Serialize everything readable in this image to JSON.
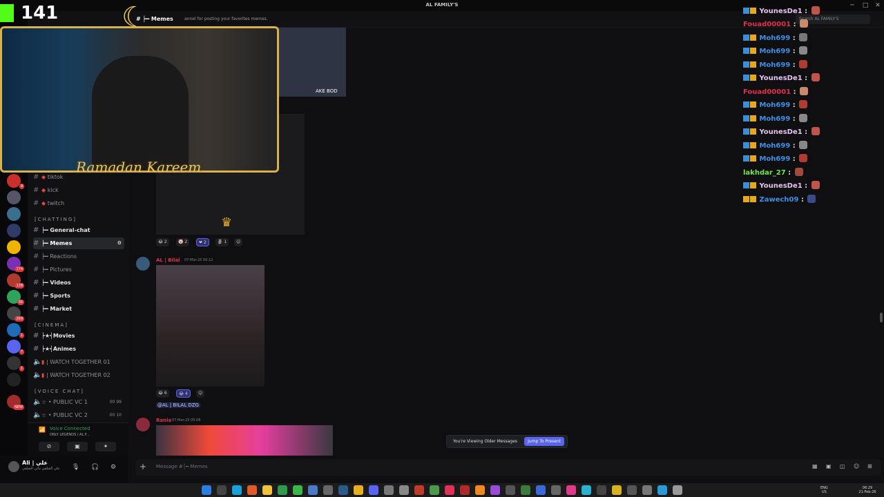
{
  "window": {
    "title": "AL FAMILY'S"
  },
  "server": {
    "name": "AL FAMILY'S"
  },
  "channel": {
    "name": "Memes",
    "topic": "annel for posting your favorites memes."
  },
  "search": {
    "placeholder": "Search AL FAMILY'S"
  },
  "channels": [
    {
      "name": "tiktok",
      "type": "text",
      "bold": false
    },
    {
      "name": "kick",
      "type": "text",
      "bold": false
    },
    {
      "name": "twitch",
      "type": "text",
      "bold": false
    }
  ],
  "categories": {
    "chatting": "[CHATTING]",
    "cinema": "[CINEMA]",
    "voice": "[VOICE CHAT]"
  },
  "chatting_channels": [
    {
      "name": "General-chat",
      "bold": true,
      "active": false
    },
    {
      "name": "Memes",
      "bold": true,
      "active": true
    },
    {
      "name": "Reactions",
      "bold": false,
      "active": false
    },
    {
      "name": "Pictures",
      "bold": false,
      "active": false
    },
    {
      "name": "Videos",
      "bold": true,
      "active": false
    },
    {
      "name": "Sports",
      "bold": true,
      "active": false
    },
    {
      "name": "Market",
      "bold": true,
      "active": false
    }
  ],
  "cinema_channels": [
    {
      "name": "Movies"
    },
    {
      "name": "Animes"
    },
    {
      "name": "WATCH TOGETHER 01"
    },
    {
      "name": "WATCH TOGETHER 02"
    }
  ],
  "voice_channels": [
    {
      "name": "PUBLIC VC 1",
      "count": "00",
      "limit": "99"
    },
    {
      "name": "PUBLIC VC 2",
      "count": "00",
      "limit": "10"
    }
  ],
  "voice": {
    "status": "Voice Connected",
    "sub": "ONLY LEGENDS / AL F..."
  },
  "user": {
    "name": "Ali | علي",
    "status": "علي الشلفي ماني الشلفي"
  },
  "messages": [
    {
      "reactions": [
        "2",
        "2",
        "2",
        "1"
      ]
    },
    {
      "author": "AL | Bilal",
      "timestamp": "07-Mar-25 00:12",
      "reactions": [
        "6",
        "4"
      ],
      "mention": "@AL | BILAL DZG"
    },
    {
      "author": "Rania",
      "timestamp": "07-Mar-25 05:08"
    }
  ],
  "older": {
    "text": "You're Viewing Older Messages",
    "button": "Jump To Present"
  },
  "composer": {
    "placeholder": "Message #│━ Memes"
  },
  "stream": {
    "viewers": "141",
    "banner": "Ramadan Kareem",
    "overlay_text": "AKE BOD"
  },
  "chat": [
    {
      "user": "YounesDe1",
      "color": "#e6c3f0"
    },
    {
      "user": "Fouad00001",
      "color": "#e0304a"
    },
    {
      "user": "Moh699",
      "color": "#3d8fe8"
    },
    {
      "user": "Moh699",
      "color": "#3d8fe8"
    },
    {
      "user": "Moh699",
      "color": "#3d8fe8"
    },
    {
      "user": "YounesDe1",
      "color": "#e6c3f0"
    },
    {
      "user": "Fouad00001",
      "color": "#e0304a"
    },
    {
      "user": "Moh699",
      "color": "#3d8fe8"
    },
    {
      "user": "Moh699",
      "color": "#3d8fe8"
    },
    {
      "user": "YounesDe1",
      "color": "#e6c3f0"
    },
    {
      "user": "Moh699",
      "color": "#3d8fe8"
    },
    {
      "user": "Moh699",
      "color": "#3d8fe8"
    },
    {
      "user": "lakhdar_27",
      "color": "#6fe84a"
    },
    {
      "user": "YounesDe1",
      "color": "#e6c3f0"
    },
    {
      "user": "Zawech09",
      "color": "#3d8fe8"
    }
  ],
  "server_badges": [
    "9",
    "174",
    "128",
    "30",
    "269",
    "1",
    "7",
    "1",
    "NEW"
  ],
  "tray": {
    "lang": "ENG",
    "region": "US",
    "time": "06:29",
    "date": "21-Feb-26"
  },
  "colors": {
    "accent": "#5865f2",
    "voice": "#23a55a",
    "gold": "#d9b24a"
  }
}
